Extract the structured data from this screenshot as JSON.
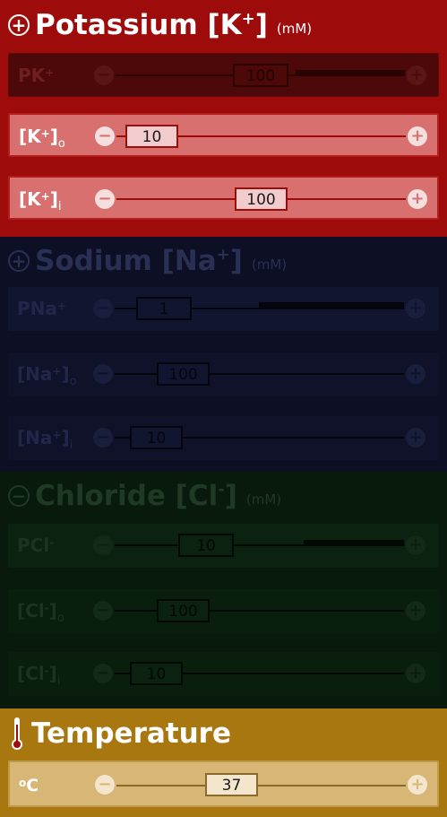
{
  "potassium": {
    "title": "Potassium [K",
    "title_sup": "+",
    "title_end": "]",
    "unit": "(mM)",
    "icon": "plus-circle-icon",
    "rows": [
      {
        "label": "PK",
        "sup": "+",
        "sub": "",
        "value": "100",
        "enabled": false
      },
      {
        "label": "[K",
        "sup": "+",
        "sub": "o",
        "post": "]",
        "value": "10",
        "enabled": true
      },
      {
        "label": "[K",
        "sup": "+",
        "sub": "i",
        "post": "]",
        "value": "100",
        "enabled": true
      }
    ]
  },
  "sodium": {
    "title": "Sodium [Na",
    "title_sup": "+",
    "title_end": "]",
    "unit": "(mM)",
    "icon": "plus-circle-icon",
    "rows": [
      {
        "label": "PNa",
        "sup": "+",
        "sub": "",
        "value": "1",
        "enabled": false
      },
      {
        "label": "[Na",
        "sup": "+",
        "sub": "o",
        "post": "]",
        "value": "100",
        "enabled": false
      },
      {
        "label": "[Na",
        "sup": "+",
        "sub": "i",
        "post": "]",
        "value": "10",
        "enabled": false
      }
    ]
  },
  "chloride": {
    "title": "Chloride [Cl",
    "title_sup": "-",
    "title_end": "]",
    "unit": "(mM)",
    "icon": "minus-circle-icon",
    "rows": [
      {
        "label": "PCl",
        "sup": "-",
        "sub": "",
        "value": "10",
        "enabled": false
      },
      {
        "label": "[Cl",
        "sup": "-",
        "sub": "o",
        "post": "]",
        "value": "100",
        "enabled": false
      },
      {
        "label": "[Cl",
        "sup": "-",
        "sub": "i",
        "post": "]",
        "value": "10",
        "enabled": false
      }
    ]
  },
  "temperature": {
    "title": "Temperature",
    "icon": "thermometer-icon",
    "row": {
      "label_sup": "o",
      "label": "C",
      "value": "37"
    }
  },
  "buttons": {
    "minus": "−",
    "plus": "+"
  }
}
